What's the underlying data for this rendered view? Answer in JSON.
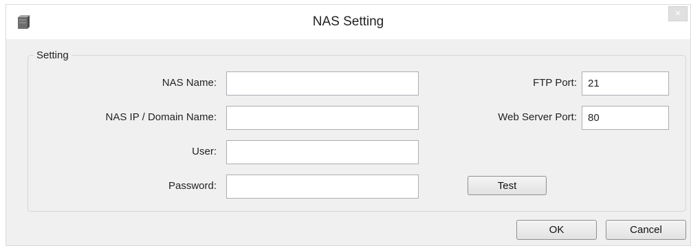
{
  "window": {
    "title": "NAS Setting",
    "close_glyph": "×",
    "app_icon": "nas-device-icon"
  },
  "group": {
    "legend": "Setting"
  },
  "fields": {
    "nas_name": {
      "label": "NAS Name:",
      "value": ""
    },
    "nas_ip": {
      "label": "NAS IP / Domain Name:",
      "value": ""
    },
    "user": {
      "label": "User:",
      "value": ""
    },
    "password": {
      "label": "Password:",
      "value": ""
    },
    "ftp_port": {
      "label": "FTP Port:",
      "value": "21"
    },
    "web_port": {
      "label": "Web Server Port:",
      "value": "80"
    }
  },
  "buttons": {
    "test": "Test",
    "ok": "OK",
    "cancel": "Cancel"
  }
}
